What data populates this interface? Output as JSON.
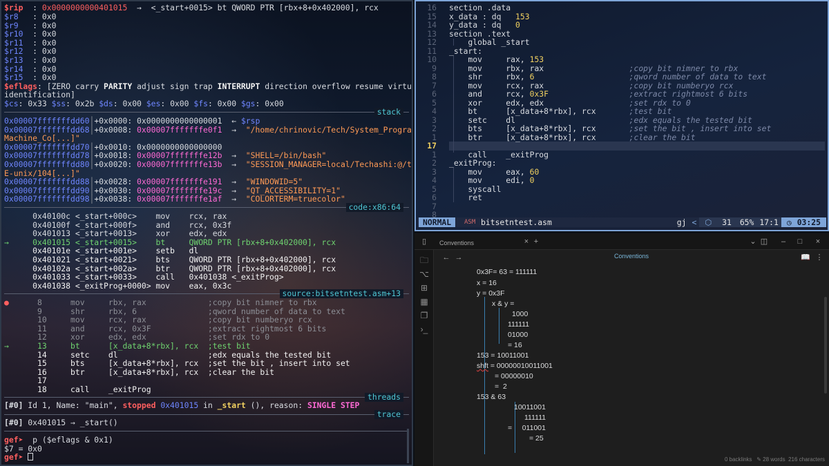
{
  "gdb": {
    "rip_name": "$rip",
    "rip_sep": "  : ",
    "rip_addr": "0x0000000000401015",
    "rip_rest": "  →  <_start+0015> bt QWORD PTR [rbx+8+0x402000], rcx",
    "regs": [
      {
        "name": "$r8 ",
        "value": "  : 0x0"
      },
      {
        "name": "$r9 ",
        "value": "  : 0x0"
      },
      {
        "name": "$r10",
        "value": "  : 0x0"
      },
      {
        "name": "$r11",
        "value": "  : 0x0"
      },
      {
        "name": "$r12",
        "value": "  : 0x0"
      },
      {
        "name": "$r13",
        "value": "  : 0x0"
      },
      {
        "name": "$r14",
        "value": "  : 0x0"
      },
      {
        "name": "$r15",
        "value": "  : 0x0"
      }
    ],
    "eflags_name": "$eflags",
    "eflags_pre": ": [ZERO carry ",
    "eflags_parity": "PARITY",
    "eflags_mid": " adjust sign trap ",
    "eflags_interrupt": "INTERRUPT",
    "eflags_post": " direction overflow resume virtualx86",
    "eflags_cont": "identification]",
    "segments": [
      {
        "name": "$cs",
        "value": ": 0x33 "
      },
      {
        "name": "$ss",
        "value": ": 0x2b "
      },
      {
        "name": "$ds",
        "value": ": 0x00 "
      },
      {
        "name": "$es",
        "value": ": 0x00 "
      },
      {
        "name": "$fs",
        "value": ": 0x00 "
      },
      {
        "name": "$gs",
        "value": ": 0x00"
      }
    ],
    "stack_label": "stack",
    "stack": [
      {
        "addr": "0x00007fffffffdd60",
        "off": "+0x0000: ",
        "val": "0x0000000000000001",
        "arrow": "  ← ",
        "note": "$rsp"
      },
      {
        "addr": "0x00007fffffffdd68",
        "off": "+0x0008: ",
        "val": "0x00007fffffffe0f1",
        "arrow": "  →  ",
        "note": "\"/home/chrinovic/Tech/System_Programming/"
      },
      {
        "cont": "Machine_Co[...]\""
      },
      {
        "addr": "0x00007fffffffdd70",
        "off": "+0x0010: ",
        "val": "0x0000000000000000",
        "arrow": "",
        "note": ""
      },
      {
        "addr": "0x00007fffffffdd78",
        "off": "+0x0018: ",
        "val": "0x00007fffffffe12b",
        "arrow": "  →  ",
        "note": "\"SHELL=/bin/bash\""
      },
      {
        "addr": "0x00007fffffffdd80",
        "off": "+0x0020: ",
        "val": "0x00007fffffffe13b",
        "arrow": "  →  ",
        "note": "\"SESSION_MANAGER=local/Techashi:@/tmp/.IC"
      },
      {
        "cont": "E-unix/104[...]\""
      },
      {
        "addr": "0x00007fffffffdd88",
        "off": "+0x0028: ",
        "val": "0x00007fffffffe191",
        "arrow": "  →  ",
        "note": "\"WINDOWID=5\""
      },
      {
        "addr": "0x00007fffffffdd90",
        "off": "+0x0030: ",
        "val": "0x00007fffffffe19c",
        "arrow": "  →  ",
        "note": "\"QT_ACCESSIBILITY=1\""
      },
      {
        "addr": "0x00007fffffffdd98",
        "off": "+0x0038: ",
        "val": "0x00007fffffffe1af",
        "arrow": "  →  ",
        "note": "\"COLORTERM=truecolor\""
      }
    ],
    "code_label": "code:x86:64",
    "code": [
      {
        "mark": "  ",
        "addr": "0x40100c <_start+000c>",
        "ins": "mov    rcx, rax",
        "cur": false
      },
      {
        "mark": "  ",
        "addr": "0x40100f <_start+000f>",
        "ins": "and    rcx, 0x3f",
        "cur": false
      },
      {
        "mark": "  ",
        "addr": "0x401013 <_start+0013>",
        "ins": "xor    edx, edx",
        "cur": false
      },
      {
        "mark": "→ ",
        "addr": "0x401015 <_start+0015>",
        "ins": "bt     QWORD PTR [rbx+8+0x402000], rcx",
        "cur": true
      },
      {
        "mark": "  ",
        "addr": "0x40101e <_start+001e>",
        "ins": "setb   dl",
        "cur": false
      },
      {
        "mark": "  ",
        "addr": "0x401021 <_start+0021>",
        "ins": "bts    QWORD PTR [rbx+8+0x402000], rcx",
        "cur": false
      },
      {
        "mark": "  ",
        "addr": "0x40102a <_start+002a>",
        "ins": "btr    QWORD PTR [rbx+8+0x402000], rcx",
        "cur": false
      },
      {
        "mark": "  ",
        "addr": "0x401033 <_start+0033>",
        "ins": "call   0x401038 <_exitProg>",
        "cur": false
      },
      {
        "mark": "  ",
        "addr": "0x401038 <_exitProg+0000>",
        "ins": "mov    eax, 0x3c",
        "cur": false
      }
    ],
    "source_label": "source:bitsetntest.asm+13",
    "source": [
      {
        "mark": "●",
        "num": "8",
        "ins": "mov     rbx, rax",
        "cmt": ";copy bit nimner to rbx",
        "kind": "past"
      },
      {
        "mark": " ",
        "num": "9",
        "ins": "shr     rbx, 6",
        "cmt": ";qword number of data to text",
        "kind": "past"
      },
      {
        "mark": " ",
        "num": "10",
        "ins": "mov     rcx, rax",
        "cmt": ";copy bit numberyo rcx",
        "kind": "past"
      },
      {
        "mark": " ",
        "num": "11",
        "ins": "and     rcx, 0x3F",
        "cmt": ";extract rightmost 6 bits",
        "kind": "past"
      },
      {
        "mark": " ",
        "num": "12",
        "ins": "xor     edx, edx",
        "cmt": ";set rdx to 0",
        "kind": "past"
      },
      {
        "mark": "→",
        "num": "13",
        "ins": "bt      [x_data+8*rbx], rcx",
        "cmt": ";test bit",
        "kind": "cur"
      },
      {
        "mark": " ",
        "num": "14",
        "ins": "setc    dl",
        "cmt": ";edx equals the tested bit",
        "kind": "next"
      },
      {
        "mark": " ",
        "num": "15",
        "ins": "bts     [x_data+8*rbx], rcx",
        "cmt": ";set the bit , insert into set",
        "kind": "next"
      },
      {
        "mark": " ",
        "num": "16",
        "ins": "btr     [x_data+8*rbx], rcx",
        "cmt": ";clear the bit",
        "kind": "next"
      },
      {
        "mark": " ",
        "num": "17",
        "ins": "",
        "cmt": "",
        "kind": "next"
      },
      {
        "mark": " ",
        "num": "18",
        "ins": "call    _exitProg",
        "cmt": "",
        "kind": "next"
      }
    ],
    "threads_label": "threads",
    "thread_id": "[#0]",
    "thread_pre": " Id 1, Name: \"main\", ",
    "thread_stopped": "stopped",
    "thread_addr": " 0x401015",
    "thread_in": " in ",
    "thread_fn": "_start",
    "thread_reason": " (), reason: ",
    "thread_step": "SINGLE STEP",
    "trace_label": "trace",
    "trace_id": "[#0]",
    "trace_text": " 0x401015 → _start()",
    "prompt": "gef➤",
    "cmd": "  p ($eflags & 0x1)",
    "result": "$7 = 0x0",
    "prompt2": "gef➤"
  },
  "nvim": {
    "lines": [
      {
        "n": "16",
        "code": "section .data",
        "cmt": ""
      },
      {
        "n": "15",
        "code": "x_data : dq   ",
        "num": "153",
        "cmt": ""
      },
      {
        "n": "14",
        "code": "y_data : dq   ",
        "num": "0",
        "cmt": ""
      },
      {
        "n": "13",
        "code": "section .text",
        "cmt": ""
      },
      {
        "n": "12",
        "code": "    global _start",
        "cmt": ""
      },
      {
        "n": "11",
        "code": "_start:",
        "cmt": ""
      },
      {
        "n": "10",
        "code": "    mov     rax, ",
        "num": "153",
        "cmt": ""
      },
      {
        "n": "9",
        "code": "    mov     rbx, rax                  ",
        "cmt": ";copy bit nimner to rbx"
      },
      {
        "n": "8",
        "code": "    shr     rbx, ",
        "num": "6",
        "pad": "                    ",
        "cmt": ";qword number of data to text"
      },
      {
        "n": "7",
        "code": "    mov     rcx, rax                  ",
        "cmt": ";copy bit numberyo rcx"
      },
      {
        "n": "6",
        "code": "    and     rcx, ",
        "num": "0x3F",
        "pad": "                 ",
        "cmt": ";extract rightmost 6 bits"
      },
      {
        "n": "5",
        "code": "    xor     edx, edx                  ",
        "cmt": ";set rdx to 0"
      },
      {
        "n": "4",
        "code": "    bt      [x_data+8*rbx], rcx       ",
        "cmt": ";test bit"
      },
      {
        "n": "3",
        "code": "    setc    dl                        ",
        "cmt": ";edx equals the tested bit"
      },
      {
        "n": "2",
        "code": "    bts     [x_data+8*rbx], rcx       ",
        "cmt": ";set the bit , insert into set"
      },
      {
        "n": "1",
        "code": "    btr     [x_data+8*rbx], rcx       ",
        "cmt": ";clear the bit"
      },
      {
        "n": "17",
        "code": "",
        "cmt": "",
        "cur": true
      },
      {
        "n": "1",
        "code": "    call    _exitProg",
        "cmt": ""
      },
      {
        "n": "2",
        "code": "_exitProg:",
        "cmt": ""
      },
      {
        "n": "3",
        "code": "    mov     eax, ",
        "num": "60",
        "cmt": ""
      },
      {
        "n": "4",
        "code": "    mov     edi, ",
        "num": "0",
        "cmt": ""
      },
      {
        "n": "5",
        "code": "    syscall",
        "cmt": ""
      },
      {
        "n": "6",
        "code": "    ret",
        "cmt": ""
      },
      {
        "n": "7",
        "code": "",
        "cmt": ""
      },
      {
        "n": "8",
        "code": "",
        "cmt": ""
      },
      {
        "n": "9",
        "code": "",
        "cmt": ""
      }
    ],
    "mode": "NORMAL",
    "filetype": "ASM",
    "filename": "bitsetntest.asm",
    "keys": "gj",
    "lsp": "31",
    "percent": "65%",
    "position": "17:1",
    "clock": "03:25",
    "accent": "#7ea5d8"
  },
  "obsidian": {
    "tab_title": "Conventions",
    "doc_title": "Conventions",
    "lines": [
      "0x3F= 63 = 111111",
      "x = 16",
      "y = 0x3F",
      "x & y =",
      "1000",
      "111111",
      "01000",
      "= 16",
      "153 = 10011001",
      "shft",
      " = 00000010011001",
      "= 00000010",
      "=  2",
      "153 & 63",
      "10011001",
      "111111",
      "=     011001",
      "= 25"
    ],
    "footer": {
      "backlinks": "0 backlinks",
      "words": "28 words",
      "chars": "216 characters"
    },
    "accent": "#7ab6d9"
  }
}
